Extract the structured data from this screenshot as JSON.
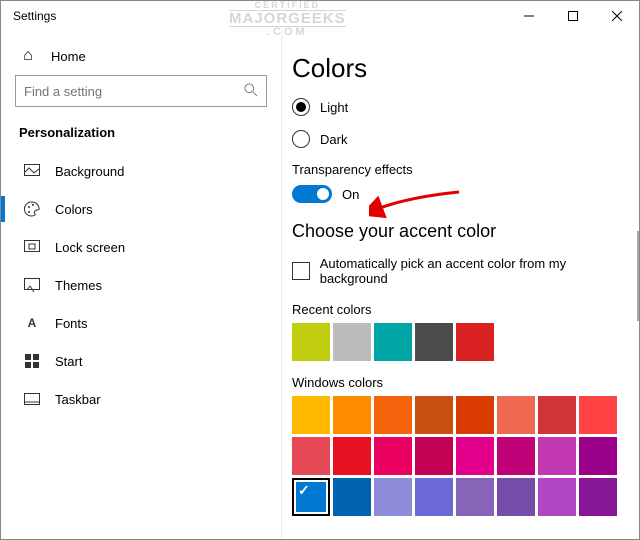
{
  "window": {
    "title": "Settings"
  },
  "sidebar": {
    "home": "Home",
    "search_placeholder": "Find a setting",
    "heading": "Personalization",
    "items": [
      {
        "label": "Background"
      },
      {
        "label": "Colors"
      },
      {
        "label": "Lock screen"
      },
      {
        "label": "Themes"
      },
      {
        "label": "Fonts"
      },
      {
        "label": "Start"
      },
      {
        "label": "Taskbar"
      }
    ]
  },
  "main": {
    "title": "Colors",
    "radios": {
      "light": "Light",
      "dark": "Dark"
    },
    "transparency": {
      "label": "Transparency effects",
      "state": "On"
    },
    "accent_heading": "Choose your accent color",
    "auto_pick": "Automatically pick an accent color from my background",
    "recent_label": "Recent colors",
    "recent_colors": [
      "#c0cc0e",
      "#bcbcbc",
      "#00a6a6",
      "#4c4c4c",
      "#d92121"
    ],
    "windows_label": "Windows colors",
    "windows_colors": [
      [
        "#ffb900",
        "#ff8c00",
        "#f7630c",
        "#ca5010",
        "#da3b01",
        "#ef6950",
        "#d13438",
        "#ff4343"
      ],
      [
        "#e74856",
        "#e81123",
        "#ea005e",
        "#c30052",
        "#e3008c",
        "#bf0077",
        "#c239b3",
        "#9a0089"
      ],
      [
        "#0078d4",
        "#0063b1",
        "#8e8cd8",
        "#6b69d6",
        "#8764b8",
        "#744da9",
        "#b146c2",
        "#881798"
      ]
    ],
    "selected_color": "#0078d4"
  }
}
